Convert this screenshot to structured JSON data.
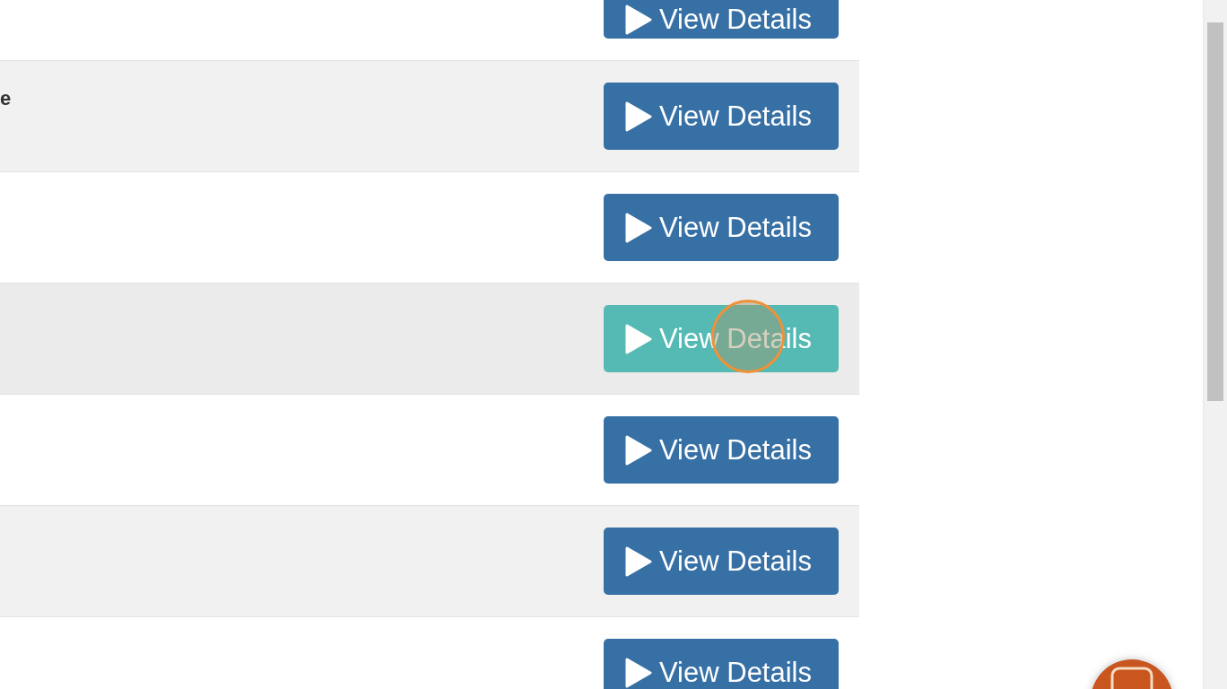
{
  "rows": [
    {
      "button": "View Details",
      "highlighted": false
    },
    {
      "cell_text": "e",
      "button": "View Details",
      "highlighted": false
    },
    {
      "button": "View Details",
      "highlighted": false
    },
    {
      "button": "View Details",
      "highlighted": true
    },
    {
      "button": "View Details",
      "highlighted": false
    },
    {
      "button": "View Details",
      "highlighted": false
    },
    {
      "button": "View Details",
      "highlighted": false
    }
  ]
}
